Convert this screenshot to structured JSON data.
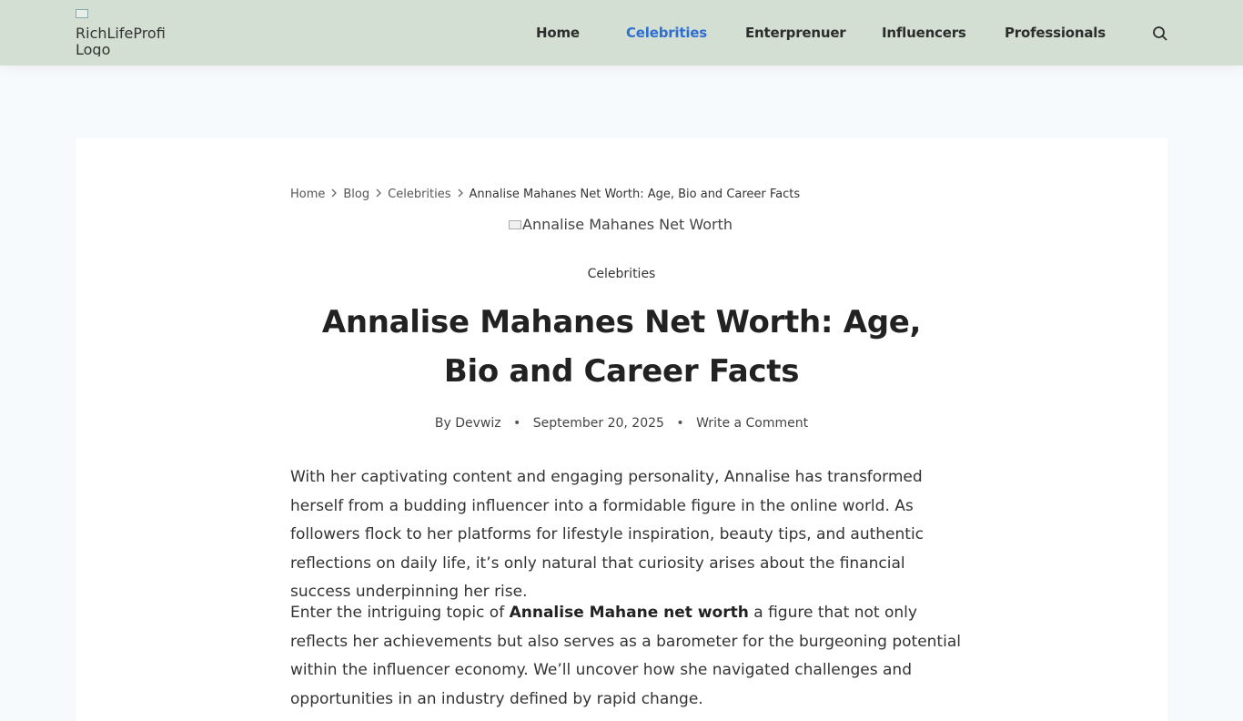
{
  "header": {
    "logo_alt": "RichLifeProfi Logo",
    "nav": [
      {
        "label": "Home",
        "active": false
      },
      {
        "label": "Celebrities",
        "active": true
      },
      {
        "label": "Enterprenuer",
        "active": false
      },
      {
        "label": "Influencers",
        "active": false
      },
      {
        "label": "Professionals",
        "active": false
      }
    ],
    "search_icon": "search-icon"
  },
  "breadcrumb": {
    "items": [
      "Home",
      "Blog",
      "Celebrities"
    ],
    "current": "Annalise Mahanes Net Worth: Age, Bio and Career Facts"
  },
  "article": {
    "featured_image_alt": "Annalise Mahanes Net Worth",
    "category": "Celebrities",
    "title": "Annalise Mahanes Net Worth: Age, Bio and Career Facts",
    "meta": {
      "by": "By",
      "author": "Devwiz",
      "date": "September 20, 2025",
      "comment": "Write a Comment"
    },
    "paragraphs": {
      "p1": "With her captivating content and engaging personality, Annalise has transformed herself from a budding influencer into a formidable figure in the online world. As followers flock to her platforms for lifestyle inspiration, beauty tips, and authentic reflections on daily life, it’s only natural that curiosity arises about the financial success underpinning her rise.",
      "p2_before": "Enter the intriguing topic of",
      "p2_bold": "Annalise Mahane net worth",
      "p2_after": "a figure that not only reflects her achievements but also serves as a barometer for the burgeoning potential within the influencer economy. We’ll uncover how she navigated challenges and opportunities in an industry defined by rapid change."
    }
  },
  "colors": {
    "header_bg": "#d3dfd3",
    "accent": "#2f6fd1",
    "page_bg": "#f7fafd"
  }
}
